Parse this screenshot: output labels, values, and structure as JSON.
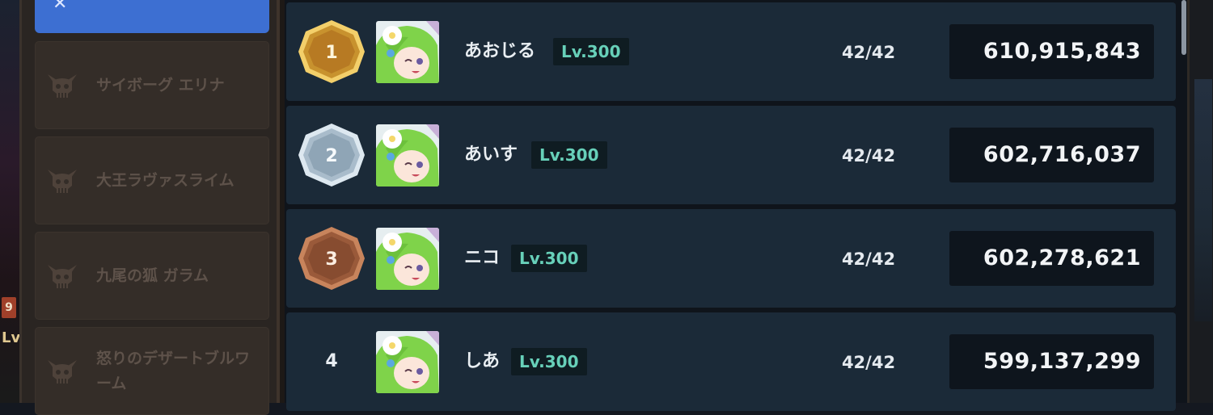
{
  "sidebar": {
    "active_icon": "crossed-swords-icon",
    "items": [
      {
        "label": "サイボーグ エリナ",
        "icon": "horned-skull-icon"
      },
      {
        "label": "大王ラヴァスライム",
        "icon": "horned-skull-icon"
      },
      {
        "label": "九尾の狐 ガラム",
        "icon": "horned-skull-icon"
      },
      {
        "label": "怒りのデザートブルワーム",
        "icon": "horned-skull-icon"
      }
    ]
  },
  "left_edge": {
    "tag": "9",
    "lv": "Lv"
  },
  "colors": {
    "gold": "#c8922e",
    "silver": "#a9bccb",
    "bronze": "#9a5a3a",
    "level_text": "#67d0b9",
    "row_bg": "#1b2a38",
    "active_tab": "#3d6fd2"
  },
  "ranking": [
    {
      "rank": "1",
      "badge": "gold-hexagon-badge",
      "name": "あおじる",
      "level": "Lv.300",
      "progress": "42/42",
      "score": "610,915,843"
    },
    {
      "rank": "2",
      "badge": "silver-hexagon-badge",
      "name": "あいす",
      "level": "Lv.300",
      "progress": "42/42",
      "score": "602,716,037"
    },
    {
      "rank": "3",
      "badge": "bronze-hexagon-badge",
      "name": "ニコ",
      "level": "Lv.300",
      "progress": "42/42",
      "score": "602,278,621"
    },
    {
      "rank": "4",
      "badge": "",
      "name": "しあ",
      "level": "Lv.300",
      "progress": "42/42",
      "score": "599,137,299"
    }
  ]
}
